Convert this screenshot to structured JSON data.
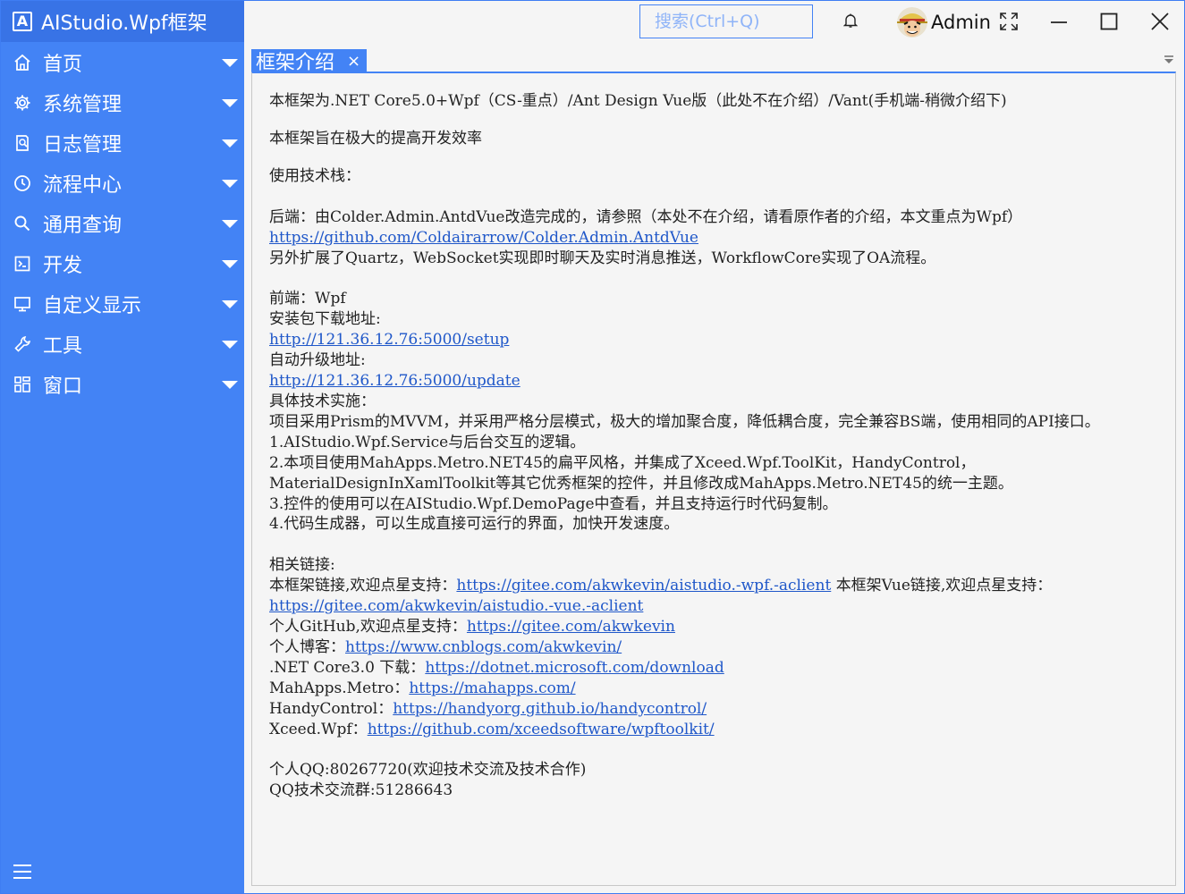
{
  "app": {
    "title": "AIStudio.Wpf框架",
    "logo_letter": "A",
    "accent_color": "#4383f5",
    "header_color": "#3873e6"
  },
  "sidebar": {
    "items": [
      {
        "label": "首页",
        "icon": "home-icon"
      },
      {
        "label": "系统管理",
        "icon": "gear-icon"
      },
      {
        "label": "日志管理",
        "icon": "log-icon"
      },
      {
        "label": "流程中心",
        "icon": "clock-icon"
      },
      {
        "label": "通用查询",
        "icon": "search-icon"
      },
      {
        "label": "开发",
        "icon": "code-icon"
      },
      {
        "label": "自定义显示",
        "icon": "monitor-icon"
      },
      {
        "label": "工具",
        "icon": "wrench-icon"
      },
      {
        "label": "窗口",
        "icon": "window-grid-icon"
      }
    ],
    "menu_toggle_icon": "hamburger-icon"
  },
  "header": {
    "search_placeholder": "搜索(Ctrl+Q)",
    "notification_icon": "bell-icon",
    "user_name": "Admin",
    "buttons": [
      "fullscreen-icon",
      "minimize-icon",
      "maximize-icon",
      "close-icon"
    ]
  },
  "tabs": [
    {
      "label": "框架介绍",
      "close": "×",
      "active": true
    }
  ],
  "content": {
    "l1": "本框架为.NET Core5.0+Wpf（CS-重点）/Ant Design Vue版（此处不在介绍）/Vant(手机端-稍微介绍下)",
    "l2": "本框架旨在极大的提高开发效率",
    "l3": "使用技术栈：",
    "backend_intro": "后端：由Colder.Admin.AntdVue改造完成的，请参照（本处不在介绍，请看原作者的介绍，本文重点为Wpf）",
    "backend_link": "https://github.com/Coldairarrow/Colder.Admin.AntdVue",
    "backend_ext": "另外扩展了Quartz，WebSocket实现即时聊天及实时消息推送，WorkflowCore实现了OA流程。",
    "frontend": "前端：Wpf",
    "setup_label": "安装包下载地址:",
    "setup_link": "http://121.36.12.76:5000/setup",
    "update_label": "自动升级地址:",
    "update_link": "http://121.36.12.76:5000/update",
    "impl_label": "具体技术实施：",
    "impl_desc": "项目采用Prism的MVVM，并采用严格分层模式，极大的增加聚合度，降低耦合度，完全兼容BS端，使用相同的API接口。",
    "impl_1": "1.AIStudio.Wpf.Service与后台交互的逻辑。",
    "impl_2": "2.本项目使用MahApps.Metro.NET45的扁平风格，并集成了Xceed.Wpf.ToolKit，HandyControl，MaterialDesignInXamlToolkit等其它优秀框架的控件，并且修改成MahApps.Metro.NET45的统一主题。",
    "impl_3": "3.控件的使用可以在AIStudio.Wpf.DemoPage中查看，并且支持运行时代码复制。",
    "impl_4": "4.代码生成器，可以生成直接可运行的界面，加快开发速度。",
    "links_label": "相关链接:",
    "link_wpf_label": "本框架链接,欢迎点星支持：",
    "link_wpf": "https://gitee.com/akwkevin/aistudio.-wpf.-aclient",
    "link_vue_label": "本框架Vue链接,欢迎点星支持：",
    "link_vue": "https://gitee.com/akwkevin/aistudio.-vue.-aclient",
    "github_label": "个人GitHub,欢迎点星支持：",
    "github_link": "https://gitee.com/akwkevin",
    "blog_label": "个人博客：",
    "blog_link": "https://www.cnblogs.com/akwkevin/",
    "net_label": ".NET Core3.0 下载：",
    "net_link": "https://dotnet.microsoft.com/download",
    "mah_label": "MahApps.Metro：",
    "mah_link": "https://mahapps.com/",
    "handy_label": "HandyControl：",
    "handy_link": "https://handyorg.github.io/handycontrol/",
    "xceed_label": "Xceed.Wpf：",
    "xceed_link": "https://github.com/xceedsoftware/wpftoolkit/",
    "qq": "个人QQ:80267720(欢迎技术交流及技术合作)",
    "qq_group": "QQ技术交流群:51286643"
  }
}
